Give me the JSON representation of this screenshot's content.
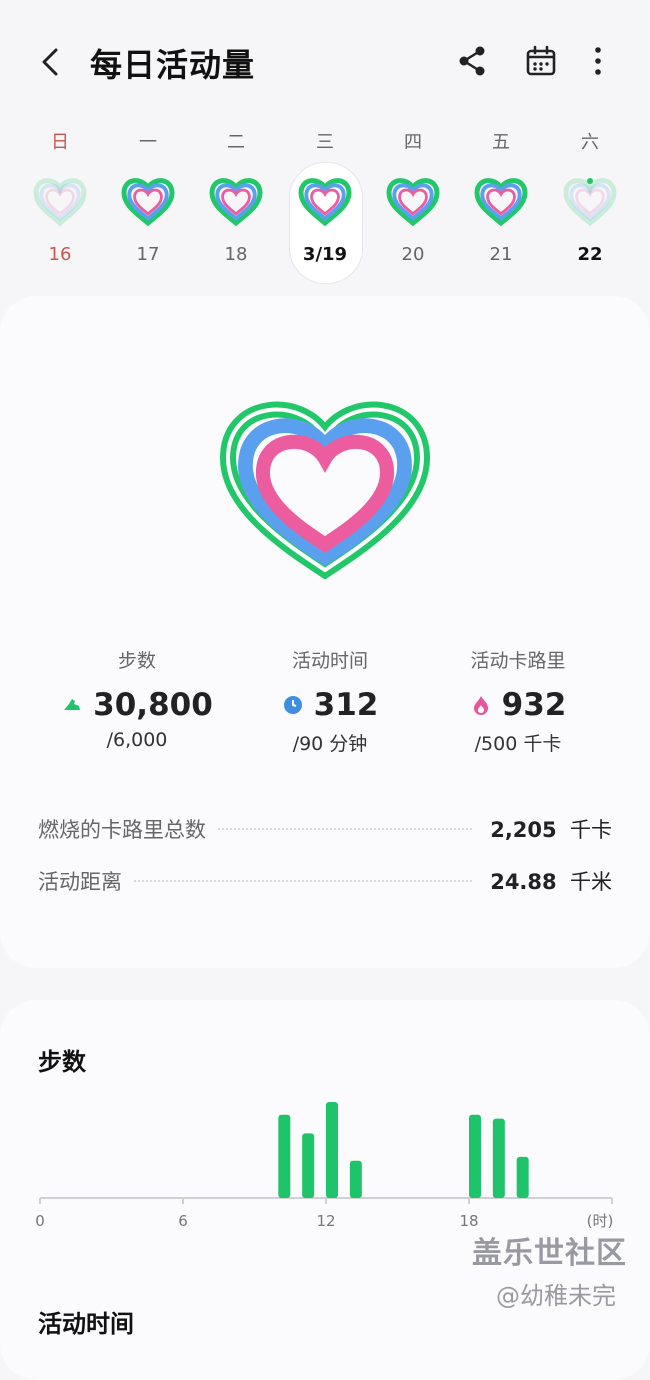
{
  "header": {
    "title": "每日活动量",
    "back_icon": "back-arrow-icon",
    "share_icon": "share-icon",
    "calendar_icon": "calendar-icon",
    "more_icon": "more-vertical-icon"
  },
  "week": [
    {
      "name": "日",
      "num": "16",
      "sunday": true,
      "state": "faded"
    },
    {
      "name": "一",
      "num": "17",
      "state": "full"
    },
    {
      "name": "二",
      "num": "18",
      "state": "full"
    },
    {
      "name": "三",
      "num": "3/19",
      "state": "full",
      "selected": true
    },
    {
      "name": "四",
      "num": "20",
      "state": "full"
    },
    {
      "name": "五",
      "num": "21",
      "state": "full"
    },
    {
      "name": "六",
      "num": "22",
      "state": "faded-dot",
      "today": true
    }
  ],
  "stats": {
    "steps": {
      "label": "步数",
      "value": "30,800",
      "goal": "/6,000",
      "icon": "shoe-icon",
      "color": "#1fc36a"
    },
    "active_time": {
      "label": "活动时间",
      "value": "312",
      "goal": "/90 分钟",
      "icon": "clock-icon",
      "color": "#3f8fe0"
    },
    "calories": {
      "label": "活动卡路里",
      "value": "932",
      "goal": "/500 千卡",
      "icon": "flame-icon",
      "color": "#e8559a"
    }
  },
  "details": [
    {
      "label": "燃烧的卡路里总数",
      "value": "2,205",
      "unit": "千卡"
    },
    {
      "label": "活动距离",
      "value": "24.88",
      "unit": "千米"
    }
  ],
  "steps_section": {
    "title": "步数"
  },
  "chart_data": {
    "type": "bar",
    "title": "步数",
    "xlabel": "",
    "ylabel": "",
    "x_ticks": [
      "0",
      "6",
      "12",
      "18",
      "(时)"
    ],
    "xlim": [
      0,
      24
    ],
    "ylim": [
      0,
      100
    ],
    "x": [
      10,
      11,
      12,
      13,
      18,
      19,
      20
    ],
    "values": [
      85,
      66,
      98,
      38,
      85,
      81,
      42
    ],
    "color": "#1fc36a"
  },
  "active_time_section": {
    "title": "活动时间"
  },
  "watermark": {
    "line1": "盖乐世社区",
    "line2": "@幼稚未完"
  },
  "colors": {
    "ring_green": "#22c76a",
    "ring_blue": "#5aa0ef",
    "ring_pink": "#ec5d9f",
    "sunday_red": "#c8564e"
  }
}
